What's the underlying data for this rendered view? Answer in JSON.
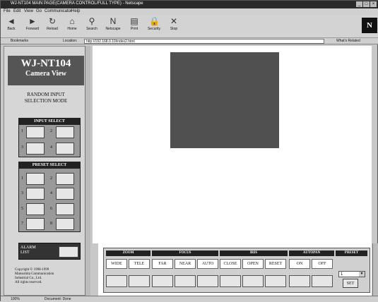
{
  "window": {
    "title": "WJ-NT104 MAIN PAGE(CAMERA CONTROL/FULL TYPE) - Netscape",
    "controls": [
      "_",
      "□",
      "×"
    ]
  },
  "menu": [
    "File",
    "Edit",
    "View",
    "Go",
    "Communicator",
    "Help"
  ],
  "toolbar": {
    "buttons": [
      {
        "label": "Back",
        "icon": "back-arrow-icon",
        "glyph": "◄"
      },
      {
        "label": "Forward",
        "icon": "forward-arrow-icon",
        "glyph": "►"
      },
      {
        "label": "Reload",
        "icon": "reload-icon",
        "glyph": "↻"
      },
      {
        "label": "Home",
        "icon": "home-icon",
        "glyph": "⌂"
      },
      {
        "label": "Search",
        "icon": "search-icon",
        "glyph": "⚲"
      },
      {
        "label": "Netscape",
        "icon": "netscape-icon",
        "glyph": "N"
      },
      {
        "label": "Print",
        "icon": "print-icon",
        "glyph": "▤"
      },
      {
        "label": "Security",
        "icon": "security-icon",
        "glyph": "🔒"
      },
      {
        "label": "Stop",
        "icon": "stop-icon",
        "glyph": "✕"
      }
    ],
    "brand": "N"
  },
  "location": {
    "bookmarks_label": "Bookmarks",
    "location_label": "Location:",
    "url": "http://192.168.0.10/index2.html",
    "whats_related": "What's Related"
  },
  "left": {
    "title_line1": "WJ-NT104",
    "title_line2": "Camera View",
    "mode_line1": "RANDOM INPUT",
    "mode_line2": "SELECTION MODE",
    "input_select": {
      "header": "INPUT SELECT",
      "numbers": [
        "1",
        "2",
        "3",
        "4"
      ]
    },
    "preset_select": {
      "header": "PRESET SELECT",
      "numbers": [
        "1",
        "2",
        "3",
        "4",
        "5",
        "6",
        "7",
        "8"
      ]
    },
    "alarm_line1": "ALARM",
    "alarm_line2": "LIST",
    "copyright": [
      "Copyright © 1998-1999",
      "Matsushita Communication",
      "Industrial Co., Ltd.",
      "All rights reserved."
    ]
  },
  "controls": {
    "groups": [
      "ZOOM",
      "FOCUS",
      "IRIS",
      "AUTOPAN",
      "PRESET"
    ],
    "buttons": [
      "WIDE",
      "TELE",
      "FAR",
      "NEAR",
      "AUTO",
      "CLOSE",
      "OPEN",
      "RESET",
      "ON",
      "OFF"
    ],
    "preset_value": "1",
    "set_label": "SET"
  },
  "status": {
    "text": "Document: Done",
    "percent": "100%"
  }
}
